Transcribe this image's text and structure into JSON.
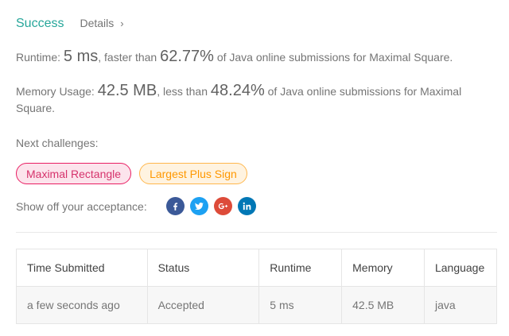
{
  "header": {
    "status": "Success",
    "details_label": "Details",
    "details_chevron": "›"
  },
  "runtime": {
    "label": "Runtime:",
    "value": "5 ms",
    "mid": ", faster than",
    "percent": "62.77%",
    "suffix": "of Java online submissions for Maximal Square."
  },
  "memory": {
    "label": "Memory Usage:",
    "value": "42.5 MB",
    "mid": ", less than",
    "percent": "48.24%",
    "suffix": "of Java online submissions for Maximal Square."
  },
  "next": {
    "label": "Next challenges:",
    "challenges": [
      {
        "title": "Maximal Rectangle",
        "color": "#e91e63"
      },
      {
        "title": "Largest Plus Sign",
        "color": "#ff9800"
      }
    ]
  },
  "share": {
    "label": "Show off your acceptance:",
    "icons": [
      {
        "name": "facebook-icon",
        "color": "#3b5998"
      },
      {
        "name": "twitter-icon",
        "color": "#1da1f2"
      },
      {
        "name": "google-plus-icon",
        "color": "#dd4b39"
      },
      {
        "name": "linkedin-icon",
        "color": "#0077b5"
      }
    ]
  },
  "table": {
    "headers": [
      "Time Submitted",
      "Status",
      "Runtime",
      "Memory",
      "Language"
    ],
    "rows": [
      [
        "a few seconds ago",
        "Accepted",
        "5 ms",
        "42.5 MB",
        "java"
      ]
    ]
  },
  "colors": {
    "accent": "#26a69a",
    "text": "#757575"
  }
}
